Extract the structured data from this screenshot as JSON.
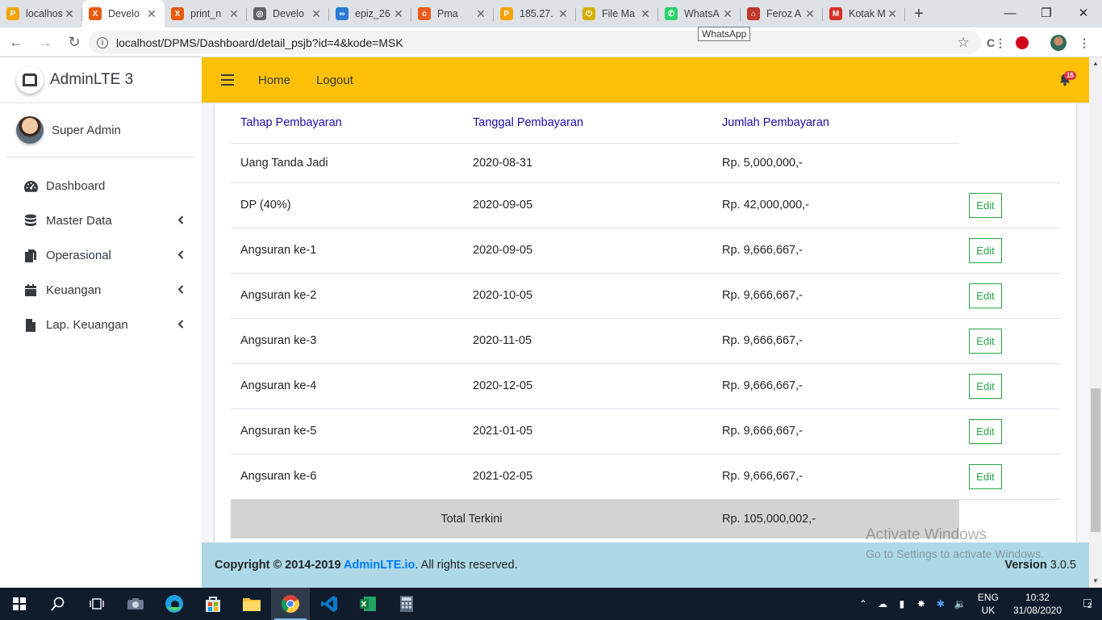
{
  "browser": {
    "tabs": [
      {
        "label": "localhost",
        "color": "#f4a300",
        "glyph": "P"
      },
      {
        "label": "Develo",
        "color": "#e8590c",
        "glyph": "X",
        "active": true
      },
      {
        "label": "print_n",
        "color": "#e8590c",
        "glyph": "X"
      },
      {
        "label": "Develo",
        "color": "#5f6368",
        "glyph": "◎"
      },
      {
        "label": "epiz_26",
        "color": "#2b7bd6",
        "glyph": "∞"
      },
      {
        "label": "Pma",
        "color": "#ea5b1c",
        "glyph": "c"
      },
      {
        "label": "185.27.",
        "color": "#f4a300",
        "glyph": "P"
      },
      {
        "label": "File Ma",
        "color": "#d4b000",
        "glyph": "⏻"
      },
      {
        "label": "WhatsA",
        "color": "#25d366",
        "glyph": "✆"
      },
      {
        "label": "Feroz A",
        "color": "#c0392b",
        "glyph": "⌂"
      },
      {
        "label": "Kotak M",
        "color": "#d93025",
        "glyph": "M"
      }
    ],
    "tooltip": "WhatsApp",
    "url": "localhost/DPMS/Dashboard/detail_psjb?id=4&kode=MSK"
  },
  "sidebar": {
    "brand": "AdminLTE 3",
    "user": "Super Admin",
    "items": [
      {
        "label": "Dashboard",
        "icon": "tachometer-icon",
        "has_submenu": false
      },
      {
        "label": "Master Data",
        "icon": "database-icon",
        "has_submenu": true
      },
      {
        "label": "Operasional",
        "icon": "copy-icon",
        "has_submenu": true
      },
      {
        "label": "Keuangan",
        "icon": "calendar-icon",
        "has_submenu": true
      },
      {
        "label": "Lap. Keuangan",
        "icon": "file-icon",
        "has_submenu": true
      }
    ]
  },
  "navbar": {
    "links": [
      "Home",
      "Logout"
    ],
    "notification_count": "15",
    "accent": "#ffc107"
  },
  "table": {
    "headers": [
      "Tahap Pembayaran",
      "Tanggal Pembayaran",
      "Jumlah Pembayaran"
    ],
    "rows": [
      {
        "stage": "Uang Tanda Jadi",
        "date": "2020-08-31",
        "amount": "Rp. 5,000,000,-",
        "editable": false
      },
      {
        "stage": "DP (40%)",
        "date": "2020-09-05",
        "amount": "Rp. 42,000,000,-",
        "editable": true
      },
      {
        "stage": "Angsuran ke-1",
        "date": "2020-09-05",
        "amount": "Rp. 9,666,667,-",
        "editable": true
      },
      {
        "stage": "Angsuran ke-2",
        "date": "2020-10-05",
        "amount": "Rp. 9,666,667,-",
        "editable": true
      },
      {
        "stage": "Angsuran ke-3",
        "date": "2020-11-05",
        "amount": "Rp. 9,666,667,-",
        "editable": true
      },
      {
        "stage": "Angsuran ke-4",
        "date": "2020-12-05",
        "amount": "Rp. 9,666,667,-",
        "editable": true
      },
      {
        "stage": "Angsuran ke-5",
        "date": "2021-01-05",
        "amount": "Rp. 9,666,667,-",
        "editable": true
      },
      {
        "stage": "Angsuran ke-6",
        "date": "2021-02-05",
        "amount": "Rp. 9,666,667,-",
        "editable": true
      }
    ],
    "edit_label": "Edit",
    "total_label": "Total Terkini",
    "total_amount": "Rp. 105,000,002,-"
  },
  "footer": {
    "copyright_prefix": "Copyright © 2014-2019 ",
    "copyright_link": "AdminLTE.io",
    "copyright_suffix": ". All rights reserved.",
    "version_label": "Version",
    "version_value": "3.0.5"
  },
  "watermark": {
    "line1": "Activate Windows",
    "line2": "Go to Settings to activate Windows."
  },
  "taskbar": {
    "lang_line1": "ENG",
    "lang_line2": "UK",
    "time": "10:32",
    "date": "31/08/2020",
    "notifications": "2"
  }
}
